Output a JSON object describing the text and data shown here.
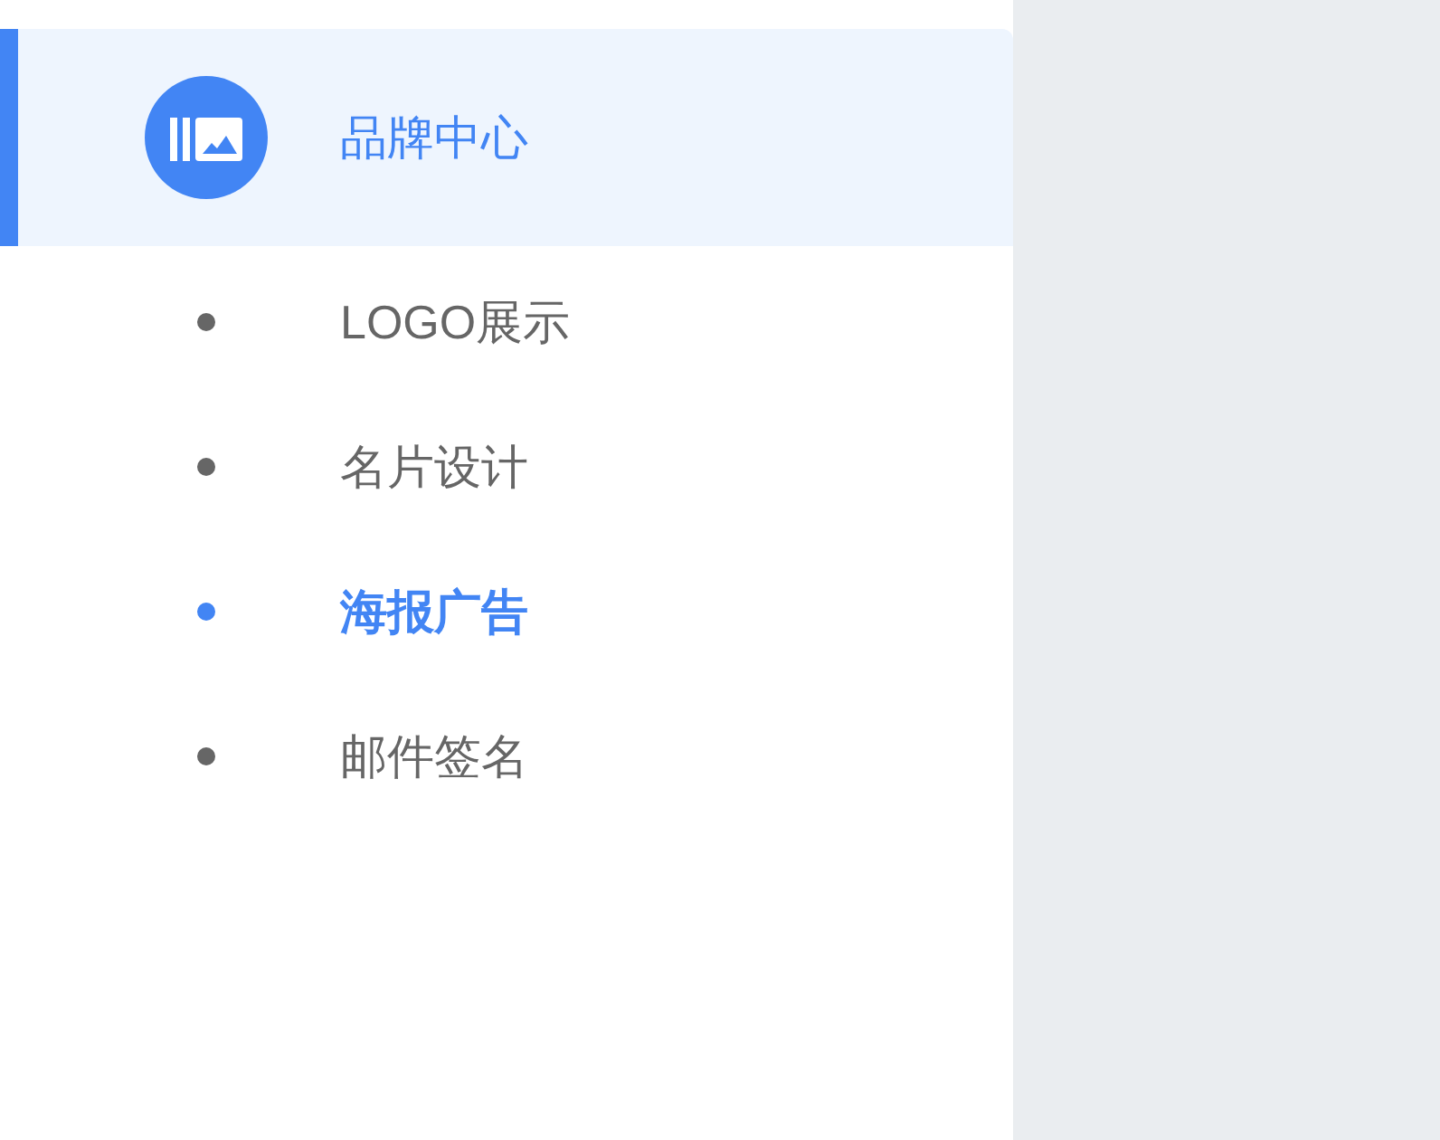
{
  "menu_group": {
    "label": "品牌中心",
    "active": true
  },
  "items": [
    {
      "label": "LOGO展示",
      "selected": false
    },
    {
      "label": "名片设计",
      "selected": false
    },
    {
      "label": "海报广告",
      "selected": true
    },
    {
      "label": "邮件签名",
      "selected": false
    }
  ]
}
